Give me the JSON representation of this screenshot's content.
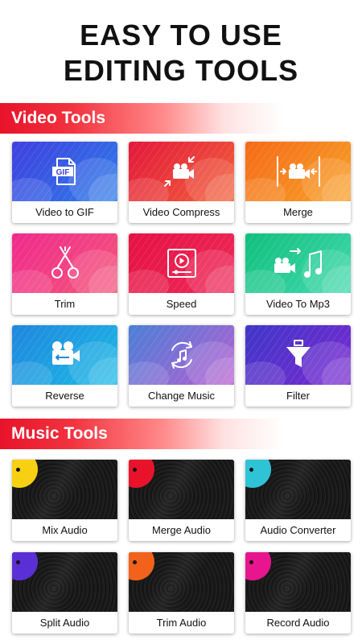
{
  "headline": {
    "line1": "EASY TO USE",
    "line2": "EDITING TOOLS"
  },
  "sections": {
    "video": {
      "title": "Video Tools"
    },
    "music": {
      "title": "Music Tools"
    }
  },
  "video_tools": [
    {
      "label": "Video to GIF",
      "icon": "gif-file-icon",
      "colors": [
        "#3f3fe0",
        "#2f7de8"
      ]
    },
    {
      "label": "Video Compress",
      "icon": "compress-video-icon",
      "colors": [
        "#e3173b",
        "#f2623a"
      ]
    },
    {
      "label": "Merge",
      "icon": "merge-video-icon",
      "colors": [
        "#f56a17",
        "#f7a22a"
      ]
    },
    {
      "label": "Trim",
      "icon": "scissors-icon",
      "colors": [
        "#f02a8c",
        "#f4567a"
      ]
    },
    {
      "label": "Speed",
      "icon": "speed-player-icon",
      "colors": [
        "#e61143",
        "#ee2a5a"
      ]
    },
    {
      "label": "Video To Mp3",
      "icon": "video-to-music-icon",
      "colors": [
        "#10bf7e",
        "#42d9ac"
      ]
    },
    {
      "label": "Reverse",
      "icon": "reverse-video-icon",
      "colors": [
        "#1e86dd",
        "#1dbbe6"
      ]
    },
    {
      "label": "Change Music",
      "icon": "change-music-icon",
      "colors": [
        "#4a7fd6",
        "#b85ed2"
      ]
    },
    {
      "label": "Filter",
      "icon": "filter-icon",
      "colors": [
        "#3f36c8",
        "#7a2ad0"
      ]
    }
  ],
  "music_tools": [
    {
      "label": "Mix Audio",
      "accent": "#f7d013"
    },
    {
      "label": "Merge Audio",
      "accent": "#e8132a"
    },
    {
      "label": "Audio Converter",
      "accent": "#2ec4d6"
    },
    {
      "label": "Split Audio",
      "accent": "#5b2fd6"
    },
    {
      "label": "Trim Audio",
      "accent": "#f2621a"
    },
    {
      "label": "Record Audio",
      "accent": "#e8168e"
    }
  ]
}
